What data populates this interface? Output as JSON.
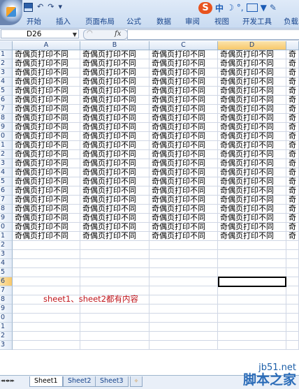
{
  "quick_access": {
    "undo": "↶",
    "redo": "↷",
    "customize": "▾"
  },
  "ime": {
    "brand": "S",
    "mode": "中"
  },
  "ribbon": {
    "tabs": [
      "开始",
      "插入",
      "页面布局",
      "公式",
      "数据",
      "审阅",
      "视图",
      "开发工具",
      "负载"
    ]
  },
  "formula_bar": {
    "name_box": "D26",
    "fx": "fx",
    "value": ""
  },
  "grid": {
    "columns": [
      "A",
      "B",
      "C",
      "D"
    ],
    "selected_column": "D",
    "row_labels": [
      "1",
      "2",
      "3",
      "4",
      "5",
      "6",
      "7",
      "8",
      "9",
      "0",
      "1",
      "2",
      "3",
      "4",
      "5",
      "6",
      "7",
      "8",
      "9",
      "0",
      "1",
      "2",
      "3",
      "4",
      "5",
      "6",
      "7",
      "8",
      "9",
      "0",
      "1",
      "2",
      "3"
    ],
    "selected_row_index": 25,
    "cell_text": "奇偶页打印不同",
    "extra_column_text": "奇",
    "filled_rows": 21,
    "active_cell": "D26"
  },
  "annotation": "sheet1、sheet2都有内容",
  "sheets": {
    "nav": "◂◂ ◂ ▸ ▸▸",
    "tabs": [
      "Sheet1",
      "Sheet2",
      "Sheet3"
    ],
    "active_index": 0
  },
  "watermark": {
    "url": "jb51.net",
    "name": "脚本之家"
  }
}
